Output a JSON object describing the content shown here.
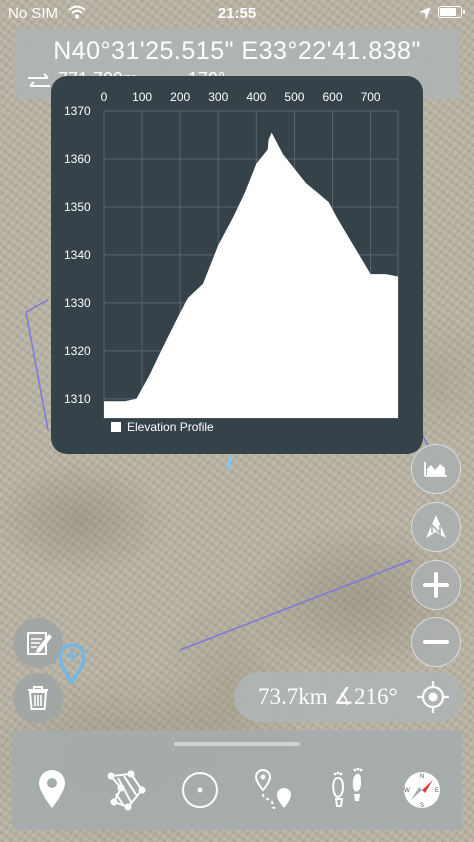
{
  "status_bar": {
    "carrier": "No SIM",
    "time": "21:55",
    "battery_level": 0.85
  },
  "coordinates": {
    "text": "N40°31'25.515\"  E33°22'41.838\"",
    "distance": "771.709m",
    "heading": "179°"
  },
  "elevation_chart": {
    "legend": "Elevation Profile",
    "x_ticks": [
      "0",
      "100",
      "200",
      "300",
      "400",
      "500",
      "600",
      "700"
    ],
    "y_ticks": [
      "1370",
      "1360",
      "1350",
      "1340",
      "1330",
      "1320",
      "1310"
    ]
  },
  "chart_data": {
    "type": "area",
    "title": "",
    "xlabel": "",
    "ylabel": "",
    "xlim": [
      0,
      772
    ],
    "ylim": [
      1306,
      1370
    ],
    "legend_position": "bottom-left",
    "grid": true,
    "fill_color": "#ffffff",
    "background_color": "#36424a",
    "series": [
      {
        "name": "Elevation Profile",
        "x": [
          0,
          25,
          55,
          85,
          120,
          150,
          200,
          220,
          260,
          300,
          340,
          370,
          400,
          430,
          432,
          440,
          470,
          500,
          530,
          560,
          590,
          610,
          640,
          670,
          700,
          740,
          772
        ],
        "y": [
          1309.5,
          1309.5,
          1309.5,
          1310,
          1315,
          1320,
          1328,
          1331,
          1334,
          1342,
          1348,
          1353,
          1359,
          1362,
          1364,
          1365.5,
          1361,
          1358,
          1355,
          1353,
          1351,
          1348,
          1344,
          1340,
          1336,
          1336,
          1335.5
        ]
      }
    ]
  },
  "info_pill": {
    "text": "73.7km ∡216°"
  },
  "colors": {
    "panel": "#36424a",
    "button": "#aab0b0",
    "track_line": "#7b78e0"
  },
  "right_buttons": [
    {
      "icon": "elevation-chart-icon"
    },
    {
      "icon": "compass-north-icon"
    },
    {
      "icon": "zoom-in-icon"
    },
    {
      "icon": "zoom-out-icon"
    }
  ],
  "toolbar": {
    "items": [
      {
        "icon": "location-pin-icon"
      },
      {
        "icon": "polygon-area-icon"
      },
      {
        "icon": "circle-point-icon"
      },
      {
        "icon": "route-pins-icon"
      },
      {
        "icon": "footprints-icon"
      },
      {
        "icon": "compass-icon"
      }
    ]
  }
}
